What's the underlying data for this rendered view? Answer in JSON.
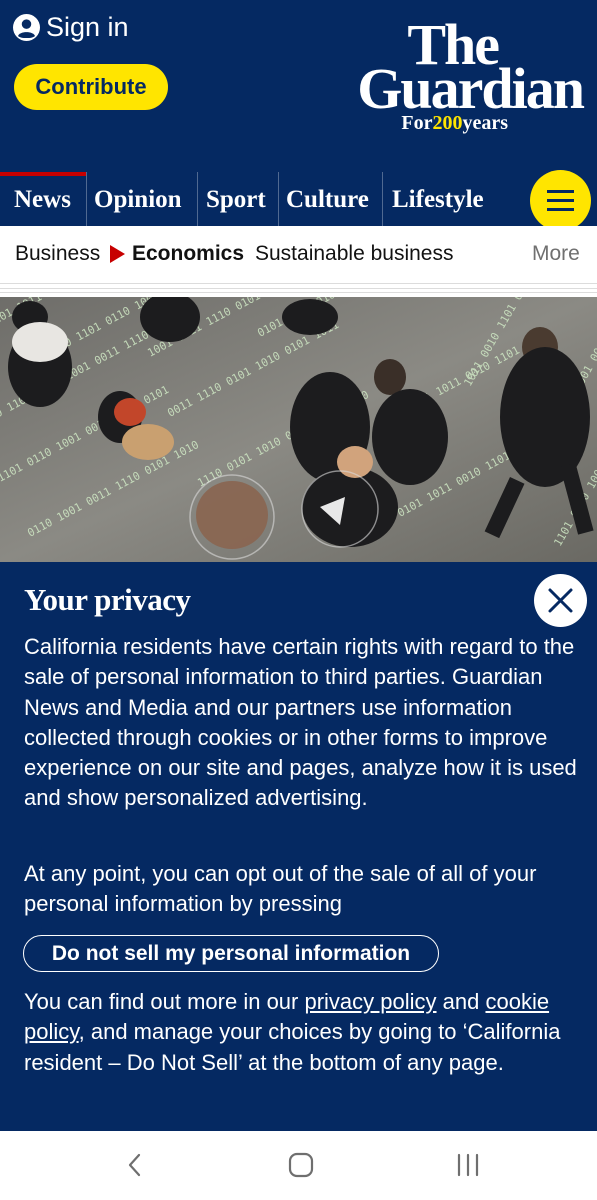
{
  "header": {
    "signin_label": "Sign in",
    "contribute_label": "Contribute",
    "logo_line1": "The",
    "logo_line2": "Guardian",
    "logo_for": "For",
    "logo_years_num": "200",
    "logo_years": "years"
  },
  "nav": {
    "pillars": [
      "News",
      "Opinion",
      "Sport",
      "Culture",
      "Lifestyle"
    ],
    "active": "News"
  },
  "subnav": {
    "items": [
      "Business",
      "Economics",
      "Sustainable business"
    ],
    "more_label": "More"
  },
  "hero": {
    "binary_glyphs": "0101 1011 0010 1101 0110 1001 0011 1110 0101 1010"
  },
  "privacy": {
    "title": "Your privacy",
    "paragraph1": "California residents have certain rights with regard to the sale of personal information to third parties. Guardian News and Media and our partners use information collected through cookies or in other forms to improve experience on our site and pages, analyze how it is used and show personalized advertising.",
    "paragraph2": "At any point, you can opt out of the sale of all of your personal information by pressing",
    "button_label": "Do not sell my personal information",
    "p3_before": "You can find out more in our ",
    "privacy_link": "privacy policy",
    "p3_and": " and ",
    "cookie_link": "cookie policy",
    "p3_after": ", and manage your choices by going to ‘California resident – Do Not Sell’ at the bottom of any page."
  },
  "colors": {
    "brand_blue": "#052962",
    "brand_yellow": "#ffe500",
    "news_red": "#c70000"
  },
  "icons": {
    "signin": "user-avatar-icon",
    "menu": "hamburger-menu-icon",
    "close": "close-x-icon",
    "back": "chevron-left-icon",
    "home": "home-icon",
    "recents": "recent-apps-icon"
  }
}
